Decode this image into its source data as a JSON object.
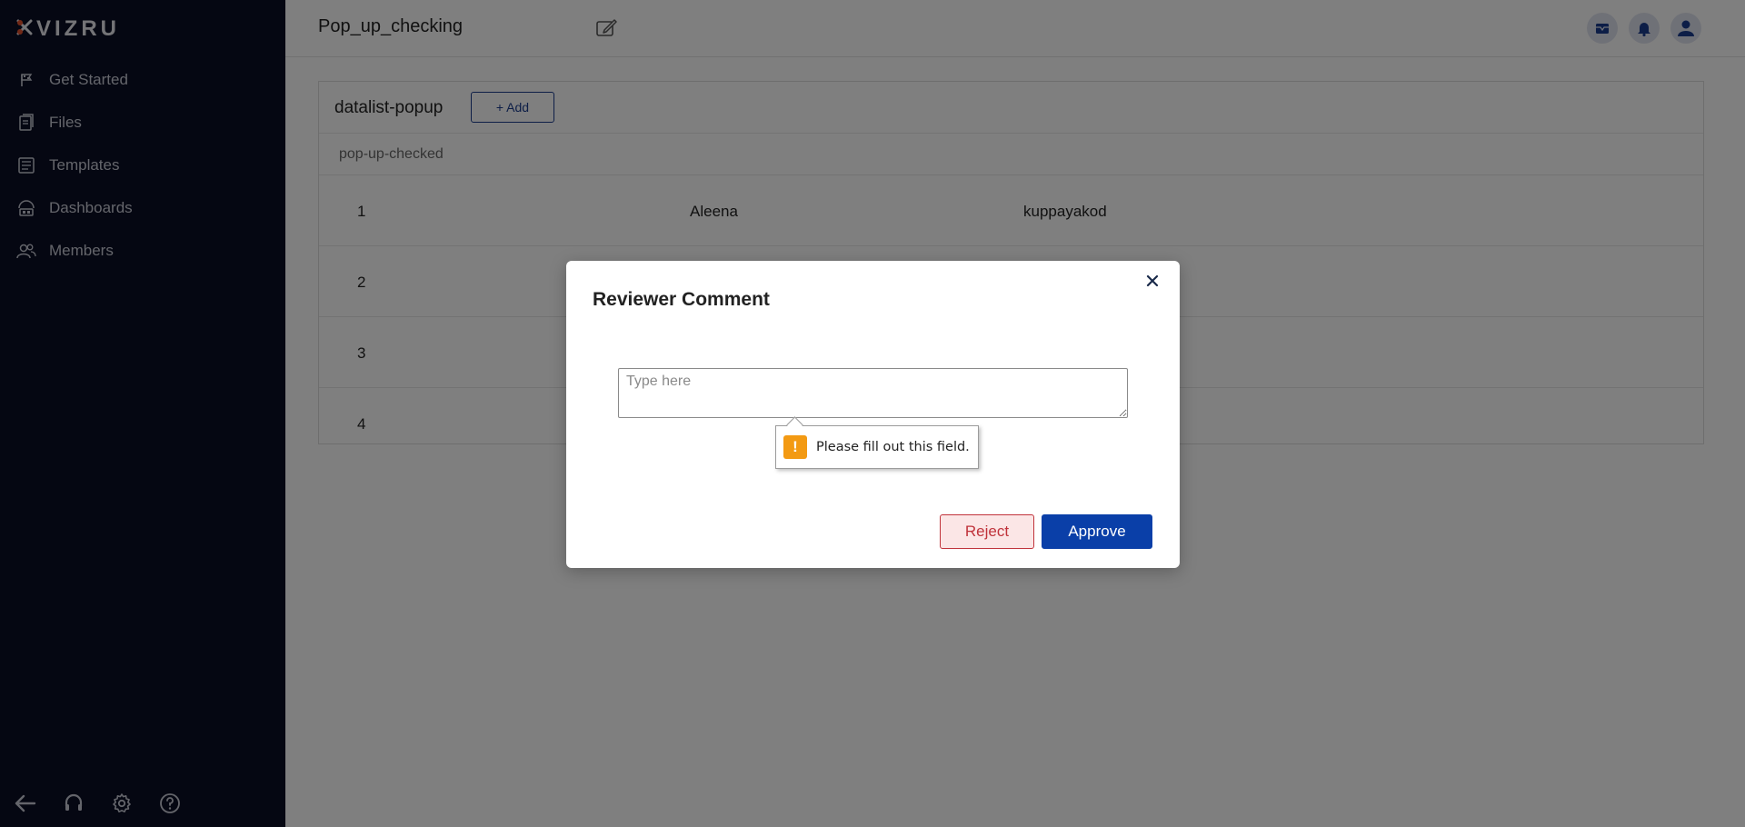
{
  "app": {
    "logo_text": "VIZRU"
  },
  "sidebar": {
    "items": [
      {
        "label": "Get Started",
        "icon": "flag-icon"
      },
      {
        "label": "Files",
        "icon": "files-icon"
      },
      {
        "label": "Templates",
        "icon": "templates-icon"
      },
      {
        "label": "Dashboards",
        "icon": "dashboard-icon"
      },
      {
        "label": "Members",
        "icon": "members-icon"
      }
    ],
    "bottom_icons": [
      "back-arrow-icon",
      "headset-icon",
      "gear-icon",
      "help-icon"
    ]
  },
  "header": {
    "title": "Pop_up_checking",
    "icons": [
      "mail-icon",
      "bell-icon",
      "user-icon"
    ]
  },
  "datalist": {
    "title": "datalist-popup",
    "add_label": "+ Add",
    "column_header": "pop-up-checked",
    "rows": [
      {
        "num": "1",
        "name": "Aleena",
        "place": "kuppayakod"
      },
      {
        "num": "2",
        "name": "",
        "place": ""
      },
      {
        "num": "3",
        "name": "",
        "place": ""
      },
      {
        "num": "4",
        "name": "",
        "place": ""
      }
    ]
  },
  "modal": {
    "title": "Reviewer Comment",
    "placeholder": "Type here",
    "validation_message": "Please fill out this field.",
    "reject_label": "Reject",
    "approve_label": "Approve"
  },
  "colors": {
    "sidebar_bg": "#0b0f24",
    "primary": "#0a3fa8",
    "danger": "#c0333b",
    "warning": "#f39a13"
  }
}
